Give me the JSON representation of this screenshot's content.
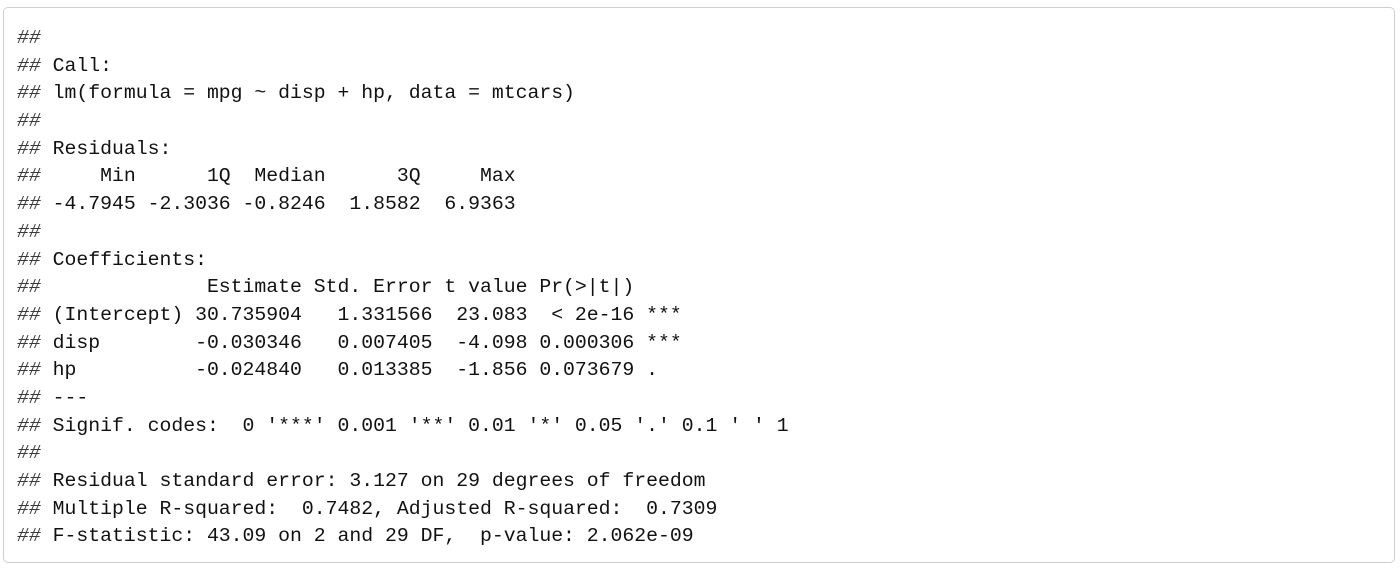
{
  "output_block": {
    "prefix": "##",
    "lines": [
      "",
      " Call:",
      " lm(formula = mpg ~ disp + hp, data = mtcars)",
      "",
      " Residuals:",
      "     Min      1Q  Median      3Q     Max ",
      " -4.7945 -2.3036 -0.8246  1.8582  6.9363 ",
      "",
      " Coefficients:",
      "              Estimate Std. Error t value Pr(>|t|)    ",
      " (Intercept) 30.735904   1.331566  23.083  < 2e-16 ***",
      " disp        -0.030346   0.007405  -4.098 0.000306 ***",
      " hp          -0.024840   0.013385  -1.856 0.073679 .  ",
      " ---",
      " Signif. codes:  0 '***' 0.001 '**' 0.01 '*' 0.05 '.' 0.1 ' ' 1",
      "",
      " Residual standard error: 3.127 on 29 degrees of freedom",
      " Multiple R-squared:  0.7482,\tAdjusted R-squared:  0.7309 ",
      " F-statistic: 43.09 on 2 and 29 DF,  p-value: 2.062e-09"
    ]
  }
}
